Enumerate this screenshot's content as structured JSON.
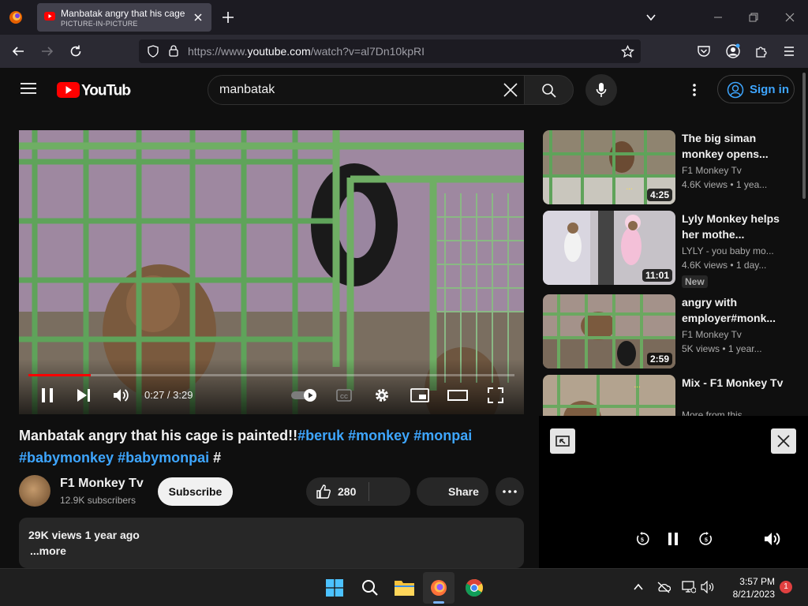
{
  "browser": {
    "tab": {
      "title": "Manbatak angry that his cage is painted!!#beruk #monkey #monpai #babymonkey #babymonpai #",
      "subtitle": "PICTURE-IN-PICTURE"
    },
    "url_prefix": "https://www.",
    "url_domain": "youtube.com",
    "url_path": "/watch?v=al7Dn10kpRI"
  },
  "youtube": {
    "logo_text": "YouTube",
    "search_query": "manbatak",
    "signin_label": "Sign in",
    "video": {
      "current_time": "0:27",
      "duration": "3:29",
      "time_display": "0:27 / 3:29",
      "progress": 0.129
    },
    "title_plain": "Manbatak angry that his cage is painted!!",
    "hashtags_line1": [
      "#beruk",
      "#monkey",
      "#monpai"
    ],
    "hashtags_line2": [
      "#babymonkey",
      "#babymonpai"
    ],
    "trailing_hash": "#",
    "channel": {
      "name": "F1 Monkey Tv",
      "subscribers": "12.9K subscribers",
      "subscribe_label": "Subscribe"
    },
    "likes": "280",
    "share_label": "Share",
    "description": {
      "meta": "29K views  1 year ago",
      "more": "...more"
    },
    "recommendations": [
      {
        "title": "The big siman monkey opens...",
        "channel": "F1 Monkey Tv",
        "views": "4.6K views  • 1 yea...",
        "duration": "4:25",
        "badge": ""
      },
      {
        "title": "Lyly Monkey helps her mothe...",
        "channel": "LYLY - you baby mo...",
        "views": "4.6K views  • 1 day...",
        "duration": "11:01",
        "badge": "New"
      },
      {
        "title": "angry with employer#monk...",
        "channel": "F1 Monkey Tv",
        "views": "5K views  • 1 year...",
        "duration": "2:59",
        "badge": ""
      },
      {
        "title": "Mix - F1 Monkey Tv",
        "channel": "More from this...",
        "views": "",
        "duration": "",
        "badge": ""
      }
    ]
  },
  "taskbar": {
    "time": "3:57 PM",
    "date": "8/21/2023",
    "notifications": "1"
  }
}
